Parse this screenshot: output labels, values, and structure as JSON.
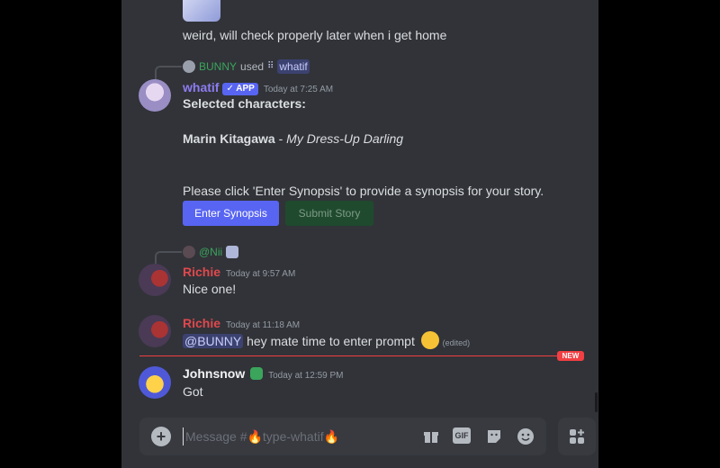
{
  "messages": {
    "prev_text": "weird, will check properly later when i get home",
    "bot": {
      "reply_user": "BUNNY",
      "reply_used": "used",
      "reply_command": "whatif",
      "username": "whatif",
      "badge": "APP",
      "timestamp": "Today at 7:25 AM",
      "heading": "Selected characters:",
      "character_name": "Marin Kitagawa",
      "character_sep": " - ",
      "character_source": "My Dress-Up Darling",
      "instruction": "Please click 'Enter Synopsis' to provide a synopsis for your story.",
      "primary_button": "Enter Synopsis",
      "secondary_button": "Submit Story"
    },
    "richie1": {
      "reply_user": "@Nii",
      "username": "Richie",
      "timestamp": "Today at 9:57 AM",
      "text": "Nice one!"
    },
    "richie2": {
      "username": "Richie",
      "timestamp": "Today at 11:18 AM",
      "mention": "@BUNNY",
      "text": "hey mate time to enter prompt",
      "edited": "(edited)"
    },
    "new_label": "NEW",
    "johnsnow": {
      "username": "Johnsnow",
      "timestamp": "Today at 12:59 PM",
      "text": "Got"
    }
  },
  "composer": {
    "placeholder": "Message #🔥type-whatif🔥"
  },
  "colors": {
    "chat_bg": "#313338",
    "blurple": "#5865f2",
    "bot_name": "#8c7cf0",
    "bunny_name": "#3ba55c",
    "richie_name": "#e0484d",
    "new_red": "#f23f43",
    "submit_green": "#248046"
  },
  "icons": [
    "add-icon",
    "gift-icon",
    "gif-icon",
    "sticker-icon",
    "emoji-icon",
    "apps-icon",
    "slash-command-icon",
    "plant-badge-icon"
  ]
}
